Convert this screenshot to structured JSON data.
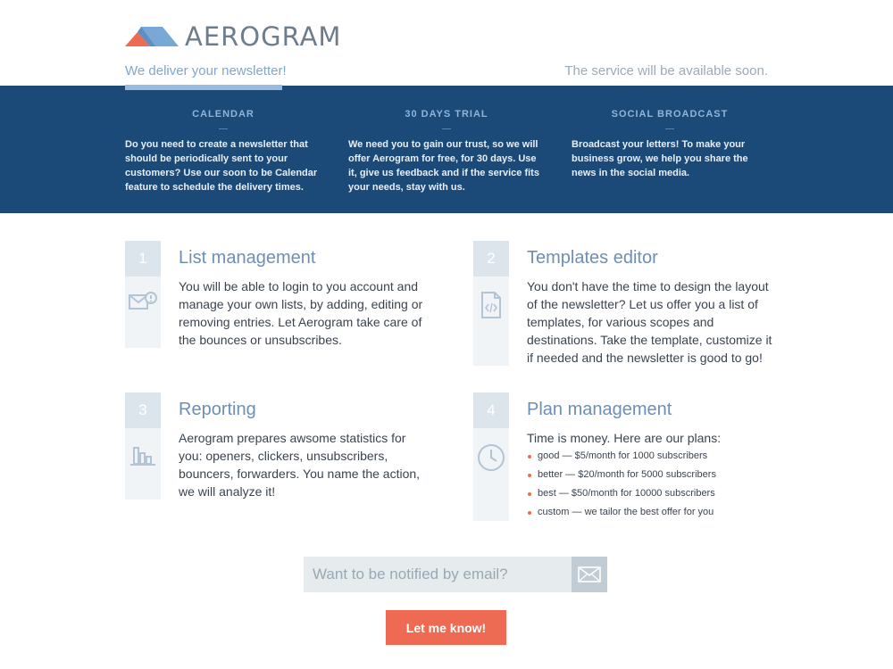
{
  "header": {
    "brand": "AEROGRAM",
    "tagline": "We deliver your newsletter!",
    "availability": "The service will be available soon.",
    "colors": {
      "logo_red": "#ee6a52",
      "logo_blue": "#79a7d6",
      "band": "#1c4a78",
      "accent": "#ee6a52"
    }
  },
  "features": [
    {
      "title": "CALENDAR",
      "text": "Do you need to create a newsletter that should be periodically sent to your customers? Use our soon to be Calendar feature to schedule the delivery times."
    },
    {
      "title": "30 DAYS TRIAL",
      "text": "We need you to gain our trust, so we will offer Aerogram for free, for 30 days. Use it, give us feedback and if the service fits your needs, stay with us."
    },
    {
      "title": "SOCIAL BROADCAST",
      "text": "Broadcast your letters! To make your business grow, we help you share the news in the social media."
    }
  ],
  "blocks": [
    {
      "number": "1",
      "icon": "envelope-alert-icon",
      "title": "List management",
      "text": "You will be able to login to you account and manage your own lists, by adding, editing or removing entries. Let Aerogram take care of the bounces or unsubscribes."
    },
    {
      "number": "2",
      "icon": "code-file-icon",
      "title": "Templates editor",
      "text": "You don't have the time to design the layout of the newsletter? Let us offer you a list of templates, for various scopes and destinations. Take the template, customize it if needed and the newsletter is good to go!"
    },
    {
      "number": "3",
      "icon": "bar-chart-icon",
      "title": "Reporting",
      "text": "Aerogram prepares awsome statistics for you: openers, clickers, unsubscribers, bouncers, forwarders. You name the action, we will analyze it!"
    },
    {
      "number": "4",
      "icon": "clock-icon",
      "title": "Plan management",
      "text": "Time is money. Here are our plans:",
      "plans": [
        "good — $5/month for 1000 subscribers",
        "better — $20/month for 5000 subscribers",
        "best — $50/month for 10000 subscribers",
        "custom — we tailor the best offer for you"
      ]
    }
  ],
  "subscribe": {
    "placeholder": "Want to be notified by email?",
    "value": "",
    "button_icon": "envelope-icon",
    "cta_label": "Let me know!"
  }
}
